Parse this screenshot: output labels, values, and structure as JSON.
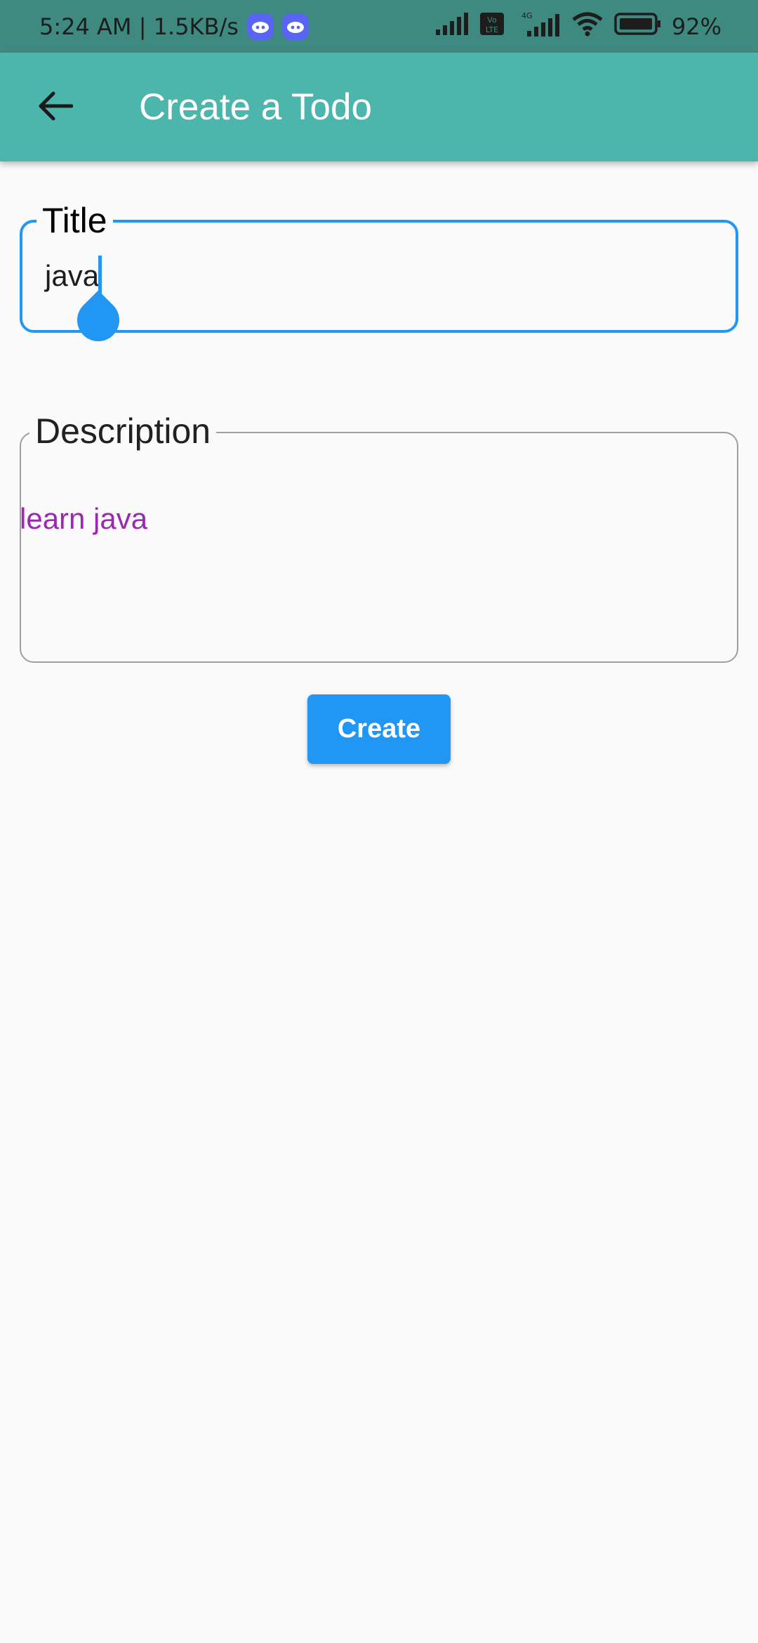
{
  "status_bar": {
    "time_speed": "5:24 AM | 1.5KB/s",
    "battery": "92%",
    "network_label": "4G",
    "volte_label": "Vo LTE"
  },
  "app_bar": {
    "title": "Create a Todo"
  },
  "form": {
    "title_label": "Title",
    "title_value": "java",
    "description_label": "Description",
    "description_value": "learn java",
    "create_label": "Create"
  },
  "colors": {
    "status_bar": "#3f8a80",
    "app_bar": "#4db6ac",
    "accent": "#2196f3",
    "description_text": "#9c27b0"
  }
}
